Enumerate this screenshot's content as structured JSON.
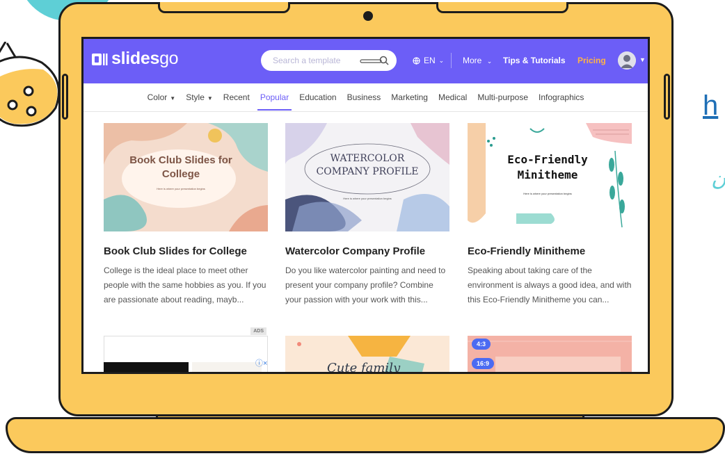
{
  "fragments": {
    "link": "h",
    "script": "ن"
  },
  "navbar": {
    "logo": {
      "bold": "slides",
      "light": "go"
    },
    "search_placeholder": "Search a template",
    "language": "EN",
    "more_label": "More",
    "tips_label": "Tips & Tutorials",
    "pricing_label": "Pricing",
    "brand_color": "#6c5ef7",
    "pricing_color": "#ffb347"
  },
  "categories": {
    "color": "Color",
    "style": "Style",
    "recent": "Recent",
    "popular": "Popular",
    "education": "Education",
    "business": "Business",
    "marketing": "Marketing",
    "medical": "Medical",
    "multipurpose": "Multi-purpose",
    "infographics": "Infographics"
  },
  "cards": [
    {
      "title": "Book Club Slides for College",
      "desc": "College is the ideal place to meet other people with the same hobbies as you. If you are passionate about reading, mayb...",
      "thumb_title": "Book Club Slides for College",
      "thumb_sub": "Here is where your presentation begins"
    },
    {
      "title": "Watercolor Company Profile",
      "desc": "Do you like watercolor painting and need to present your company profile? Combine your passion with your work with this...",
      "thumb_title_1": "WATERCOLOR",
      "thumb_title_2": "COMPANY PROFILE",
      "thumb_sub": "Here is where your presentation begins"
    },
    {
      "title": "Eco-Friendly Minitheme",
      "desc": "Speaking about taking care of the environment is always a good idea, and with this Eco-Friendly Minitheme you can...",
      "thumb_title_1": "Eco-Friendly",
      "thumb_title_2": "Minitheme",
      "thumb_sub": "Here is where your presentation begins"
    }
  ],
  "row2": {
    "ad_badge": "ADS",
    "cute_title": "Cute family",
    "ratio_a": "4:3",
    "ratio_b": "16:9"
  }
}
